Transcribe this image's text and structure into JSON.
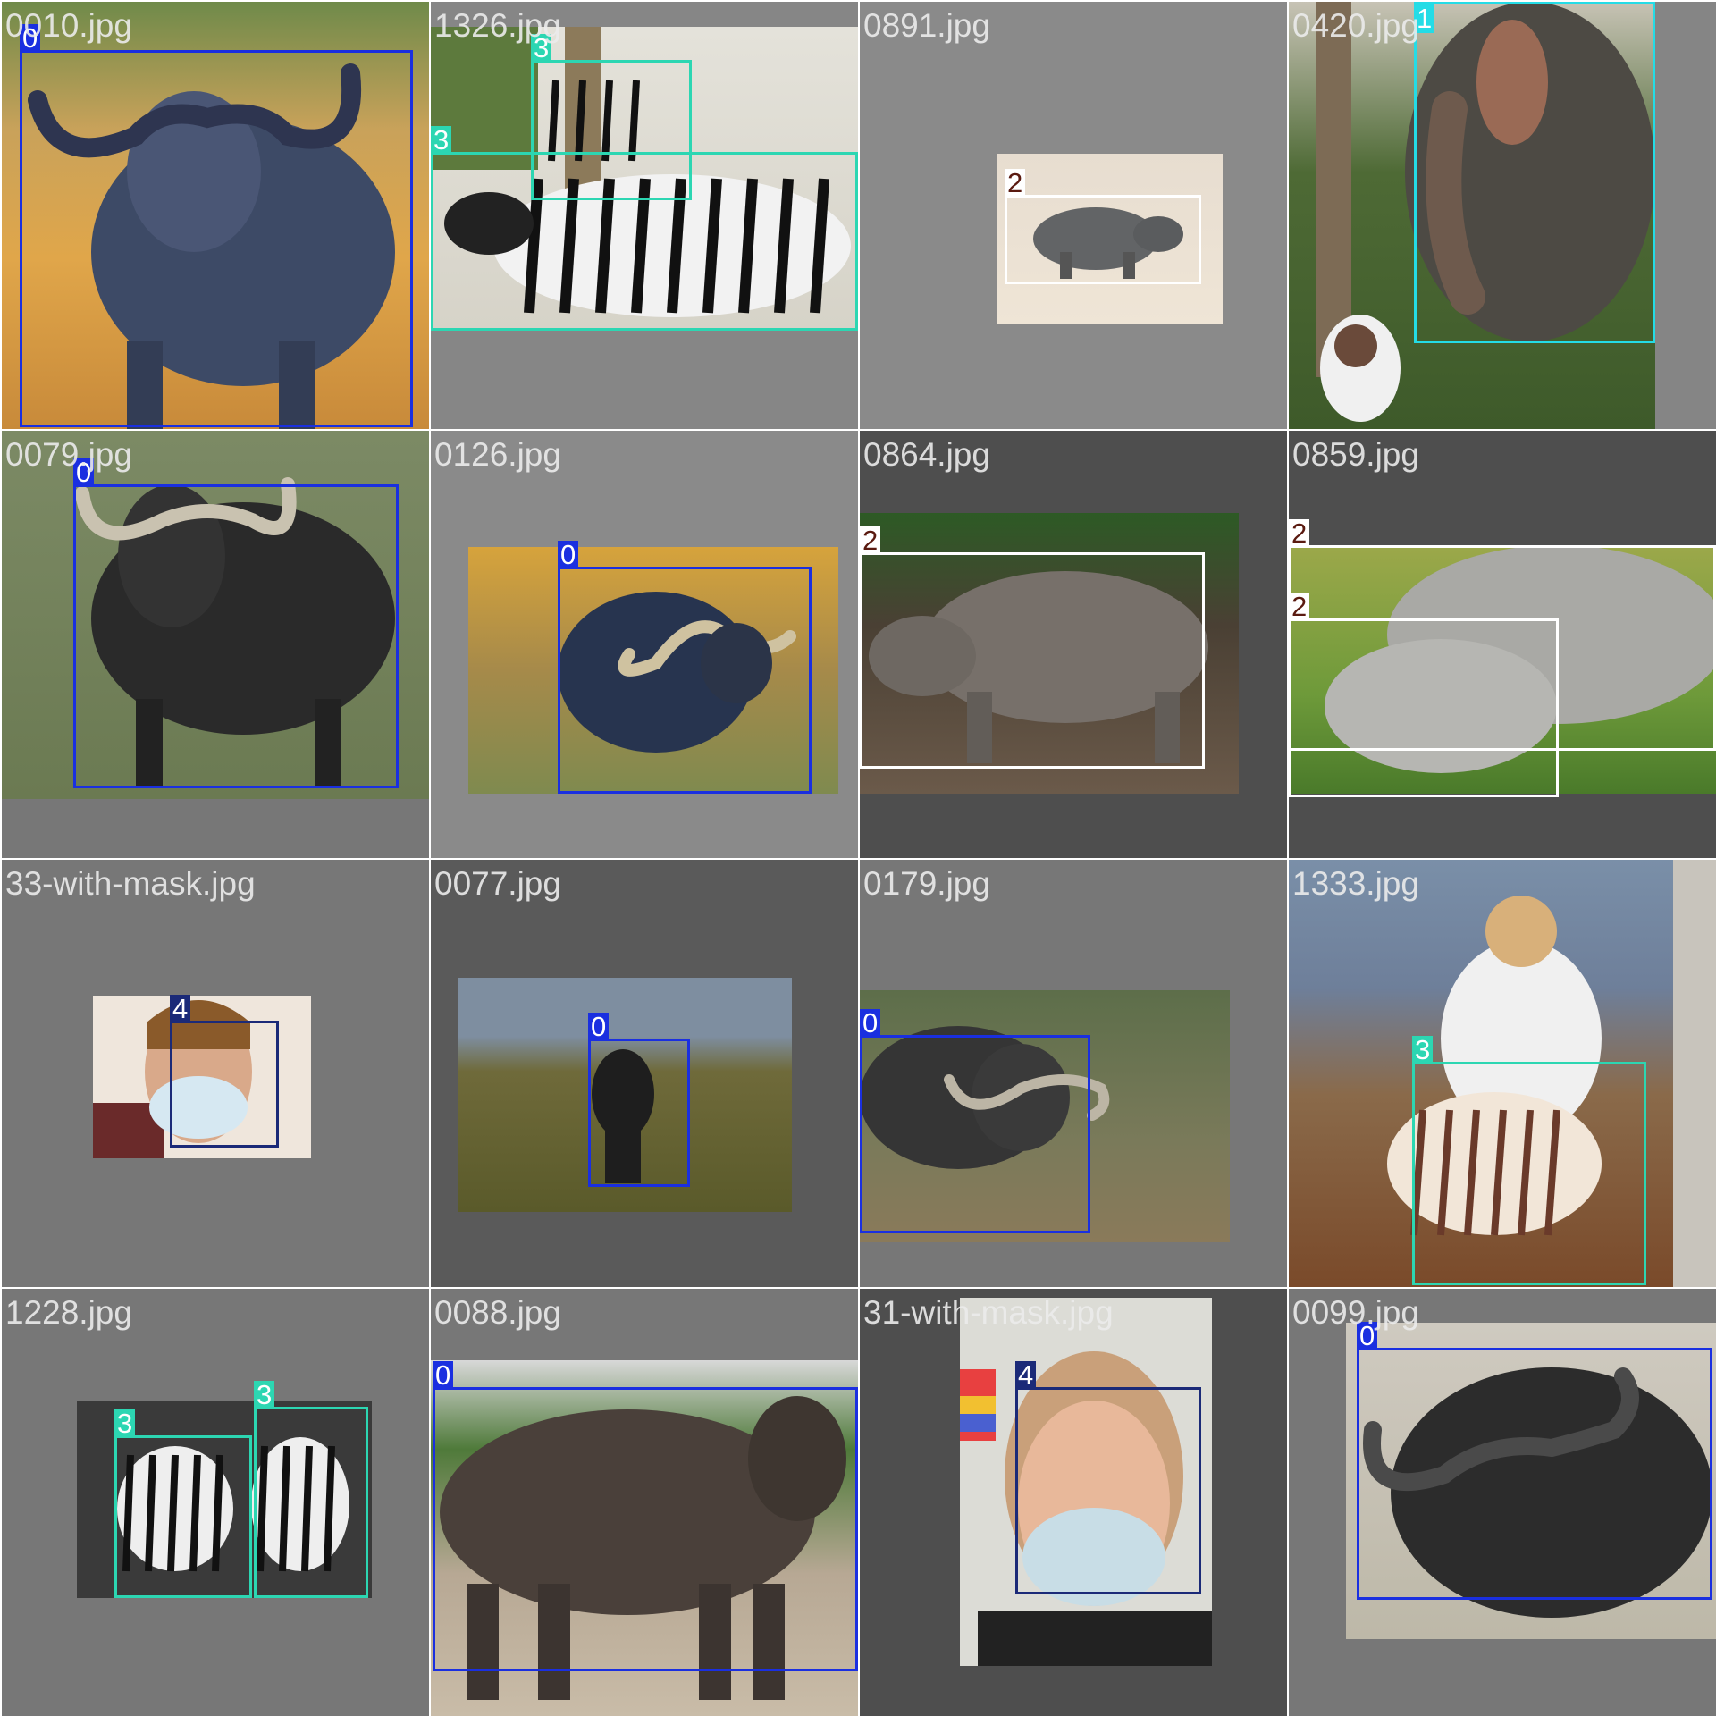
{
  "mosaic": {
    "tiles": [
      {
        "filename": "0010.jpg",
        "labels": [
          "0"
        ]
      },
      {
        "filename": "1326.jpg",
        "labels": [
          "3",
          "3"
        ]
      },
      {
        "filename": "0891.jpg",
        "labels": [
          "2"
        ]
      },
      {
        "filename": "0420.jpg",
        "labels": [
          "1"
        ]
      },
      {
        "filename": "0079.jpg",
        "labels": [
          "0"
        ]
      },
      {
        "filename": "0126.jpg",
        "labels": [
          "0"
        ]
      },
      {
        "filename": "0864.jpg",
        "labels": [
          "2"
        ]
      },
      {
        "filename": "0859.jpg",
        "labels": [
          "2",
          "2"
        ]
      },
      {
        "filename": "33-with-mask.jpg",
        "labels": [
          "4"
        ]
      },
      {
        "filename": "0077.jpg",
        "labels": [
          "0"
        ]
      },
      {
        "filename": "0179.jpg",
        "labels": [
          "0"
        ]
      },
      {
        "filename": "1333.jpg",
        "labels": [
          "3"
        ]
      },
      {
        "filename": "1228.jpg",
        "labels": [
          "3",
          "3"
        ]
      },
      {
        "filename": "0088.jpg",
        "labels": [
          "0"
        ]
      },
      {
        "filename": "31-with-mask.jpg",
        "labels": [
          "4"
        ]
      },
      {
        "filename": "0099.jpg",
        "labels": [
          "0"
        ]
      }
    ]
  },
  "class_colors": {
    "0": "#1a2fe0",
    "1": "#24dce6",
    "2": "#ffffff",
    "3": "#2cd6b2",
    "4": "#1b2a78"
  }
}
